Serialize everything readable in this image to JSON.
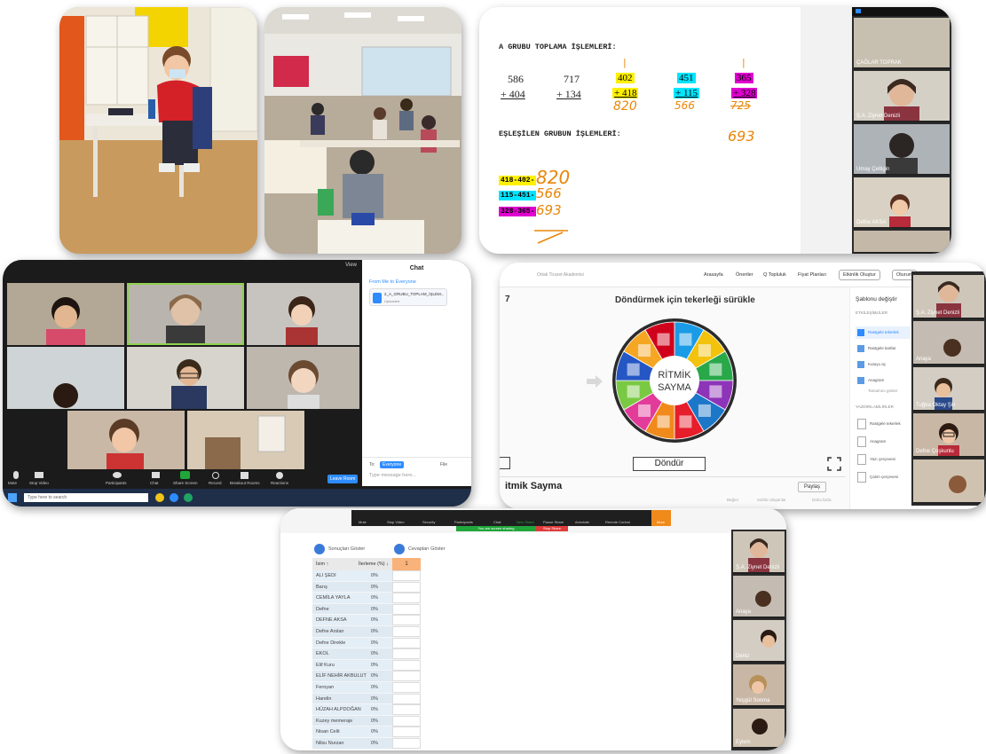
{
  "math_board": {
    "title_a": "A GRUBU TOPLAMA İŞLEMLERİ:",
    "problems": [
      {
        "top": "586",
        "bottom": "+ 404",
        "answer": ""
      },
      {
        "top": "717",
        "bottom": "+ 134",
        "answer": ""
      },
      {
        "top": "402",
        "bottom": "+ 418",
        "answer": "820",
        "color": "#fff000"
      },
      {
        "top": "451",
        "bottom": "+ 115",
        "answer": "566",
        "color": "#00e5ff"
      },
      {
        "top": "365",
        "bottom": "+ 328",
        "answer": "693",
        "color": "#e000d0"
      }
    ],
    "title_b": "EŞLEŞİLEN GRUBUN İŞLEMLERİ:",
    "pairs": [
      {
        "label": "418-402-",
        "answer": "820",
        "color": "#fff000"
      },
      {
        "label": "115-451-",
        "answer": "566",
        "color": "#00e5ff"
      },
      {
        "label": "328-365-",
        "answer": "693",
        "color": "#e000d0"
      }
    ],
    "scratch": "725",
    "participants": [
      "ÇAĞLAR TOPRAK",
      "Ş.A. Ziynet Denizli",
      "Umay Çeltigin",
      "Defne AKSA"
    ]
  },
  "zoom_gallery": {
    "top_label": "View",
    "chat_title": "Chat",
    "chat_from": "From Me to Everyone",
    "chat_file": "2_A_GRUBU_TOPLAM_İŞLEM...",
    "chat_status": "Uploaded",
    "chat_to_label": "To:",
    "chat_to_value": "Everyone",
    "chat_file_btn": "File",
    "chat_placeholder": "Type message here...",
    "toolbar": [
      "Mute",
      "Stop Video",
      "Participants",
      "Chat",
      "Share Screen",
      "Record",
      "Breakout Rooms",
      "Reactions"
    ],
    "leave": "Leave Room",
    "taskbar_search": "Type here to search"
  },
  "wheel": {
    "breadcrumb": "Ortak Ticaret Akademisi",
    "top_nav": [
      "Arasayfa",
      "Öneriler",
      "Q Topluluk",
      "Fiyat Planları",
      "Etkinlik Oluştur",
      "Oturum"
    ],
    "instruction": "Döndürmek için tekerleği sürükle",
    "center_line1": "RİTMİK",
    "center_line2": "SAYMA",
    "spin_button": "Döndür",
    "title": "itmik Sayma",
    "share_button": "Paylaş",
    "number_label": "7",
    "side_heading": "Şablonu değiştir",
    "side_section1": "ETKİLEŞİMLİLER",
    "side_items1": [
      "Rastgele tekerlek",
      "Rastgele kartlar",
      "Kutuyu aç",
      "Anagram"
    ],
    "side_more": "Tamamını göster",
    "side_section2": "YAZDIRILABİLİRLER",
    "side_items2": [
      "Rastgele tekerlek",
      "Anagram",
      "Yazı çerçevesi",
      "Çalım çerçevesi"
    ],
    "bottom_links": [
      "Beğen",
      "Sahibi Ulaşanlar",
      "Daha fazla"
    ],
    "participants": [
      "Ş.A. Ziynet Denizli",
      "Anaya",
      "Tuğba Oktay Şin",
      "Defne Çoşkunlu",
      ""
    ]
  },
  "progress_table": {
    "toggle1": "Sonuçları Göster",
    "toggle2": "Cevapları Göster",
    "col1": "İsim ↑",
    "col2": "İlerleme (%) ↓",
    "col3": "1",
    "zoom_bar": [
      "Mute",
      "Stop Video",
      "Security",
      "Participants",
      "Chat",
      "New Share",
      "Pause Share",
      "Annotate",
      "Remote Control",
      "More"
    ],
    "share_notice": "You are screen sharing",
    "stop_share": "Stop Share",
    "rows": [
      {
        "name": "ALI ŞEDI",
        "pct": "0%"
      },
      {
        "name": "Barış",
        "pct": "0%"
      },
      {
        "name": "CEMİLA YAYLA",
        "pct": "0%"
      },
      {
        "name": "Defne",
        "pct": "0%"
      },
      {
        "name": "DEFNE AKSA",
        "pct": "0%"
      },
      {
        "name": "Defne Arslan",
        "pct": "0%"
      },
      {
        "name": "Defne Direkle",
        "pct": "0%"
      },
      {
        "name": "EKOL",
        "pct": "0%"
      },
      {
        "name": "Elif Kuru",
        "pct": "0%"
      },
      {
        "name": "ELİF NEHİR AKBULUT",
        "pct": "0%"
      },
      {
        "name": "Feroyan",
        "pct": "0%"
      },
      {
        "name": "Harelin",
        "pct": "0%"
      },
      {
        "name": "HÜZAH ALPDOĞAN",
        "pct": "0%"
      },
      {
        "name": "Kuzey memeraje",
        "pct": "0%"
      },
      {
        "name": "Nisan Celit",
        "pct": "0%"
      },
      {
        "name": "Nilsu Nurzan",
        "pct": "0%"
      }
    ],
    "participants": [
      "Ş.A. Ziynet Denizli",
      "Anaya",
      "Deniz",
      "Yeşgül Sonma",
      "Eylem"
    ]
  },
  "colors": {
    "zoom_green": "#20a63a",
    "zoom_blue": "#2d8cff",
    "table_orange": "#f9b27a",
    "wheel_segments": [
      "#1a9be6",
      "#f2c20c",
      "#29a84a",
      "#8e34b8",
      "#1c77c9",
      "#e61d2b",
      "#f08a1a",
      "#e23b9a",
      "#7ac943",
      "#2456c4",
      "#f5a623",
      "#d0021b"
    ]
  }
}
